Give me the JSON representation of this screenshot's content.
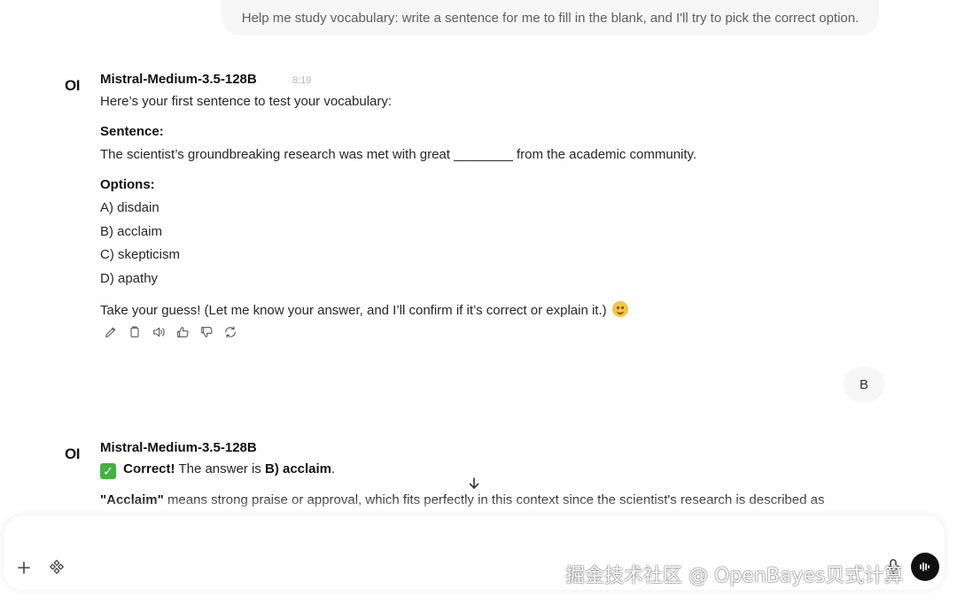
{
  "conversation": {
    "user_message_1": "Help me study vocabulary: write a sentence for me to fill in the blank, and I'll try to pick the correct option.",
    "assistant_1": {
      "avatar": "OI",
      "model_name": "Mistral-Medium-3.5-128B",
      "timestamp": "8:19",
      "intro": "Here’s your first sentence to test your vocabulary:",
      "sentence_heading": "Sentence:",
      "sentence": "The scientist’s groundbreaking research was met with great ________ from the academic community.",
      "options_heading": "Options:",
      "options": [
        "A) disdain",
        "B) acclaim",
        "C) skepticism",
        "D) apathy"
      ],
      "closing": "Take your guess! (Let me know your answer, and I’ll confirm if it’s correct or explain it.)"
    },
    "user_message_2": "B",
    "assistant_2": {
      "avatar": "OI",
      "model_name": "Mistral-Medium-3.5-128B",
      "correct_label": "Correct!",
      "answer_prefix": "The answer is",
      "answer": "B) acclaim",
      "answer_suffix": ".",
      "explain_term": "\"Acclaim\"",
      "explain_text": "means strong praise or approval, which fits perfectly in this context since the scientist's research is described as"
    }
  },
  "message_actions": [
    "edit-icon",
    "copy-icon",
    "read-aloud-icon",
    "thumbs-up-icon",
    "thumbs-down-icon",
    "regenerate-icon"
  ],
  "watermark": "掘金技术社区 @ OpenBayes贝式计算",
  "colors": {
    "accent": "#111111",
    "bubble": "#f6f6f6",
    "check": "#3fb43f"
  }
}
